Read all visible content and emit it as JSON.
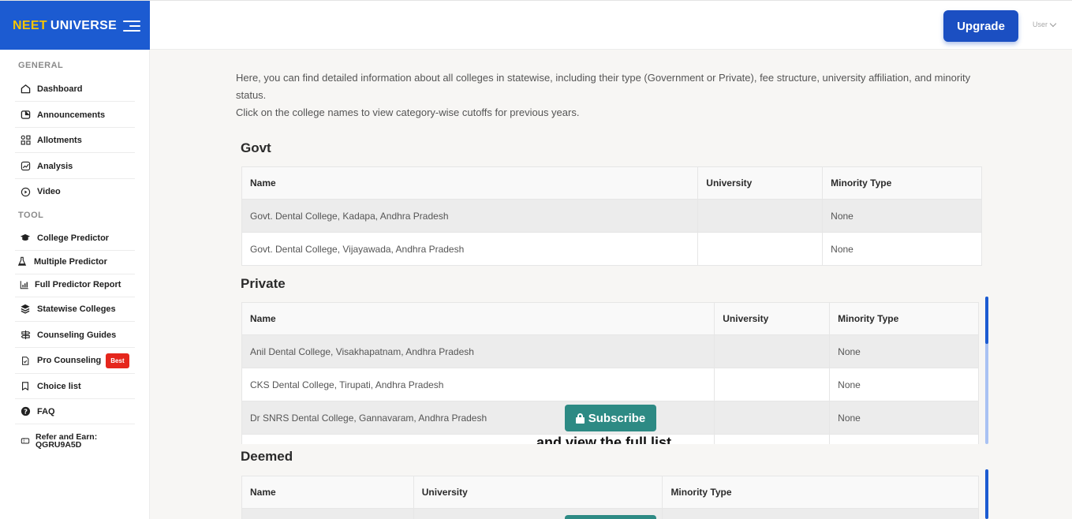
{
  "header": {
    "logo_neet": "NEET",
    "logo_universe": "UNIVERSE",
    "upgrade_label": "Upgrade",
    "user_label": "User",
    "brand_color": "#1c5bd1"
  },
  "sidebar": {
    "general_label": "GENERAL",
    "tool_label": "TOOL",
    "general_items": [
      {
        "label": "Dashboard",
        "icon": "home-icon"
      },
      {
        "label": "Announcements",
        "icon": "announcement-icon"
      },
      {
        "label": "Allotments",
        "icon": "grid-icon"
      },
      {
        "label": "Analysis",
        "icon": "chart-icon"
      },
      {
        "label": "Video",
        "icon": "play-icon"
      }
    ],
    "tool_items": [
      {
        "label": "College Predictor",
        "icon": "graduation-cap-icon"
      },
      {
        "label": "Multiple Predictor",
        "icon": "flask-icon"
      },
      {
        "label": "Full Predictor Report",
        "icon": "bar-chart-icon"
      },
      {
        "label": "Statewise Colleges",
        "icon": "layers-icon"
      },
      {
        "label": "Counseling Guides",
        "icon": "guide-icon"
      },
      {
        "label": "Pro Counseling",
        "icon": "document-icon",
        "badge": "Best"
      },
      {
        "label": "Choice list",
        "icon": "bookmark-icon"
      },
      {
        "label": "FAQ",
        "icon": "question-icon"
      },
      {
        "label": "Refer and Earn:\nQGRU9A5D",
        "icon": "ticket-icon"
      }
    ]
  },
  "main": {
    "intro_line1": "Here, you can find detailed information about all colleges in statewise, including their type (Government or Private), fee structure, university affiliation, and minority status.",
    "intro_line2": "Click on the college names to view category-wise cutoffs for previous years.",
    "columns": {
      "name": "Name",
      "university": "University",
      "minority": "Minority Type"
    },
    "govt": {
      "title": "Govt",
      "rows": [
        {
          "name": "Govt. Dental College, Kadapa, Andhra Pradesh",
          "university": "",
          "minority": "None"
        },
        {
          "name": "Govt. Dental College, Vijayawada, Andhra Pradesh",
          "university": "",
          "minority": "None"
        }
      ]
    },
    "private": {
      "title": "Private",
      "rows": [
        {
          "name": "Anil Dental College, Visakhapatnam, Andhra Pradesh",
          "university": "",
          "minority": "None"
        },
        {
          "name": "CKS Dental College, Tirupati, Andhra Pradesh",
          "university": "",
          "minority": "None"
        },
        {
          "name": "Dr SNRS Dental College, Gannavaram, Andhra Pradesh",
          "university": "",
          "minority": "None"
        }
      ]
    },
    "deemed": {
      "title": "Deemed"
    },
    "subscribe_label": "Subscribe",
    "view_list_text": "and view the full list"
  }
}
